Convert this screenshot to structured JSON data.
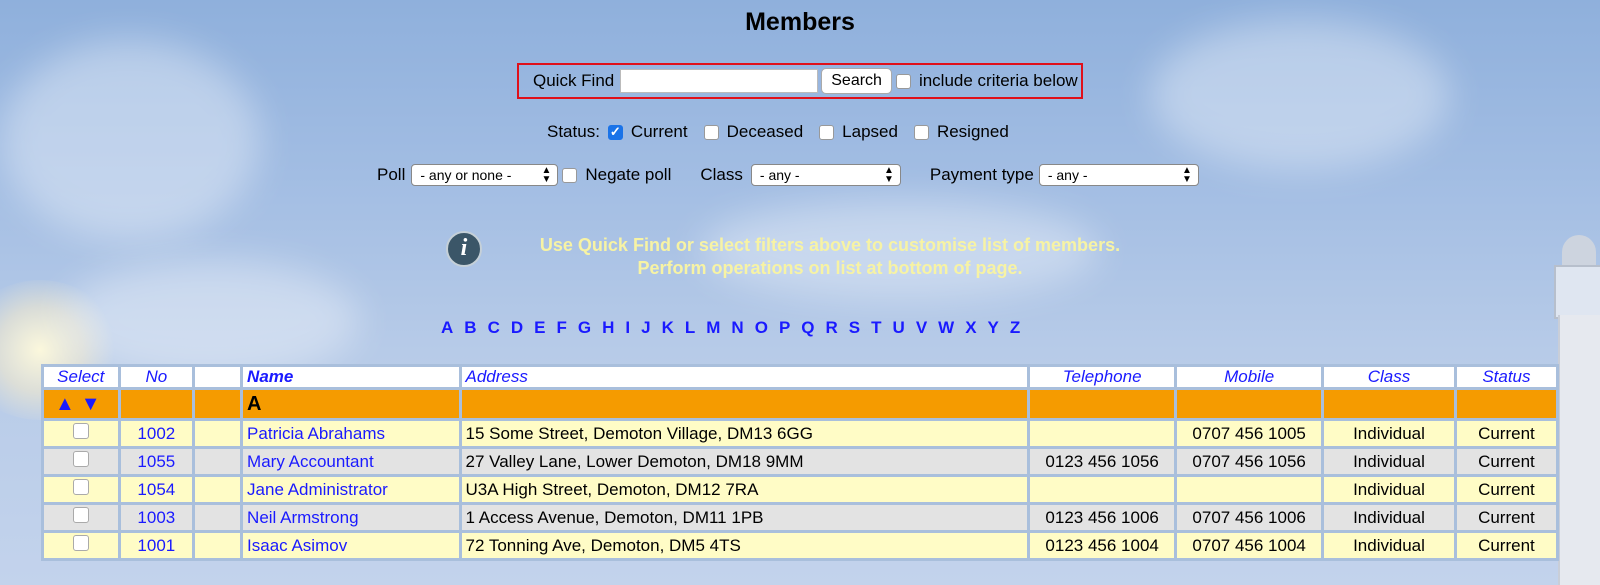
{
  "page": {
    "title": "Members"
  },
  "quick_find": {
    "label": "Quick Find",
    "value": "",
    "button": "Search",
    "include_label": "include criteria below",
    "include_checked": false
  },
  "status": {
    "label": "Status:",
    "options": [
      {
        "label": "Current",
        "checked": true
      },
      {
        "label": "Deceased",
        "checked": false
      },
      {
        "label": "Lapsed",
        "checked": false
      },
      {
        "label": "Resigned",
        "checked": false
      }
    ]
  },
  "filters": {
    "poll_label": "Poll",
    "poll_value": "- any or none -",
    "negate_label": "Negate poll",
    "negate_checked": false,
    "class_label": "Class",
    "class_value": "- any -",
    "payment_label": "Payment type",
    "payment_value": "- any -"
  },
  "info": {
    "icon": "info-icon",
    "line1": "Use Quick Find or select filters above to customise list of members.",
    "line2": "Perform operations on list at bottom of page."
  },
  "alphabet": [
    "A",
    "B",
    "C",
    "D",
    "E",
    "F",
    "G",
    "H",
    "I",
    "J",
    "K",
    "L",
    "M",
    "N",
    "O",
    "P",
    "Q",
    "R",
    "S",
    "T",
    "U",
    "V",
    "W",
    "X",
    "Y",
    "Z"
  ],
  "table": {
    "headers": {
      "select": "Select",
      "no": "No",
      "blank": "",
      "name": "Name",
      "address": "Address",
      "telephone": "Telephone",
      "mobile": "Mobile",
      "class": "Class",
      "status": "Status"
    },
    "group": {
      "letter": "A",
      "arrows": "▲▼"
    },
    "rows": [
      {
        "no": "1002",
        "name": "Patricia Abrahams",
        "address": "15 Some Street, Demoton Village, DM13 6GG",
        "telephone": "",
        "mobile": "0707 456 1005",
        "class": "Individual",
        "status": "Current"
      },
      {
        "no": "1055",
        "name": "Mary Accountant",
        "address": "27 Valley Lane, Lower Demoton, DM18 9MM",
        "telephone": "0123 456 1056",
        "mobile": "0707 456 1056",
        "class": "Individual",
        "status": "Current"
      },
      {
        "no": "1054",
        "name": "Jane Administrator",
        "address": "U3A High Street, Demoton, DM12 7RA",
        "telephone": "",
        "mobile": "",
        "class": "Individual",
        "status": "Current"
      },
      {
        "no": "1003",
        "name": "Neil Armstrong",
        "address": "1 Access Avenue, Demoton, DM11 1PB",
        "telephone": "0123 456 1006",
        "mobile": "0707 456 1006",
        "class": "Individual",
        "status": "Current"
      },
      {
        "no": "1001",
        "name": "Isaac Asimov",
        "address": "72 Tonning Ave, Demoton, DM5 4TS",
        "telephone": "0123 456 1004",
        "mobile": "0707 456 1004",
        "class": "Individual",
        "status": "Current"
      }
    ]
  }
}
